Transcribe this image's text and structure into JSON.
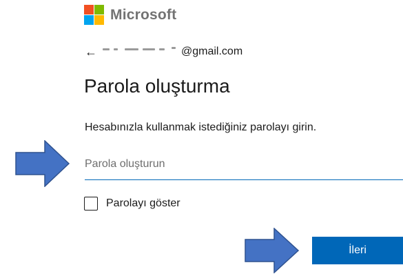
{
  "brand": {
    "name": "Microsoft",
    "colors": {
      "red": "#f25022",
      "green": "#7fba00",
      "blue": "#00a4ef",
      "yellow": "#ffb900"
    }
  },
  "identity": {
    "back_icon": "←",
    "email_domain": "@gmail.com"
  },
  "page": {
    "title": "Parola oluşturma",
    "description": "Hesabınızla kullanmak istediğiniz parolayı girin."
  },
  "password_field": {
    "placeholder": "Parola oluşturun",
    "value": ""
  },
  "show_password": {
    "label": "Parolayı göster",
    "checked": false
  },
  "actions": {
    "next_label": "İleri"
  },
  "theme": {
    "accent": "#0067b8",
    "annotation_arrow_fill": "#4472c4",
    "annotation_arrow_stroke": "#2f528f"
  }
}
